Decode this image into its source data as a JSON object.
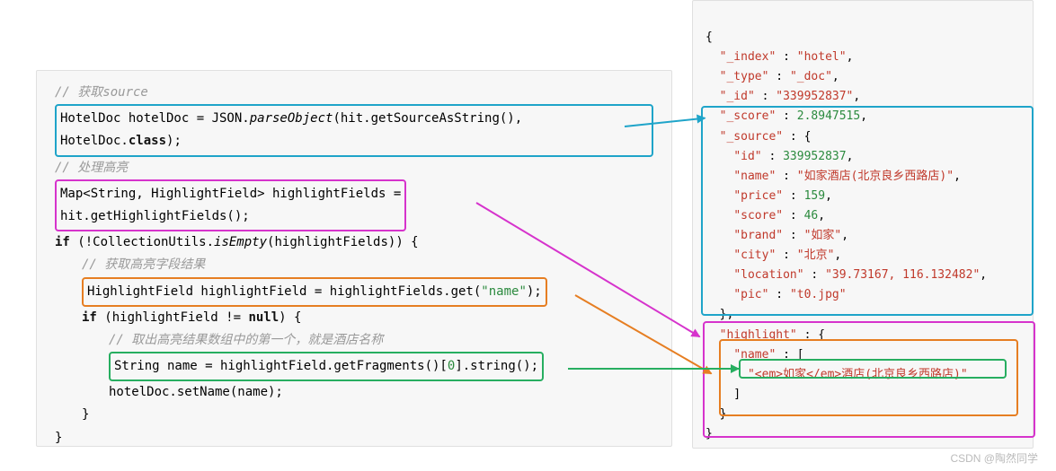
{
  "left": {
    "comment1": "// 获取source",
    "line_blue1": "HotelDoc hotelDoc = JSON.",
    "line_blue1_method": "parseObject",
    "line_blue1_tail": "(hit.getSourceAsString(),",
    "line_blue2": "HotelDoc.",
    "line_blue2_bold": "class",
    "line_blue2_tail": ");",
    "comment2": "// 处理高亮",
    "magenta_line1": "Map<String, HighlightField> highlightFields =",
    "magenta_line2": "hit.getHighlightFields();",
    "if1_a": "if",
    "if1_b": " (!CollectionUtils.",
    "if1_c": "isEmpty",
    "if1_d": "(highlightFields)) {",
    "comment3": "// 获取高亮字段结果",
    "orange_line_a": "HighlightField highlightField = highlightFields.get(",
    "orange_line_str": "\"name\"",
    "orange_line_b": ");",
    "if2_a": "if",
    "if2_b": " (highlightField != ",
    "if2_null": "null",
    "if2_c": ") {",
    "comment4": "// 取出高亮结果数组中的第一个，就是酒店名称",
    "green_line_a": "String name = highlightField.getFragments()[",
    "green_line_idx": "0",
    "green_line_b": "].string();",
    "setname": "hotelDoc.setName(name);",
    "closebrace": "}"
  },
  "right": {
    "open": "{",
    "indent": "  ",
    "index_k": "\"_index\"",
    "index_v": "\"hotel\"",
    "type_k": "\"_type\"",
    "type_v": "\"_doc\"",
    "id_k": "\"_id\"",
    "id_v": "\"339952837\"",
    "score_k": "\"_score\"",
    "score_v": "2.8947515",
    "source_k": "\"_source\"",
    "src_id_k": "\"id\"",
    "src_id_v": "339952837",
    "src_name_k": "\"name\"",
    "src_name_v": "\"如家酒店(北京良乡西路店)\"",
    "src_price_k": "\"price\"",
    "src_price_v": "159",
    "src_score_k": "\"score\"",
    "src_score_v": "46",
    "src_brand_k": "\"brand\"",
    "src_brand_v": "\"如家\"",
    "src_city_k": "\"city\"",
    "src_city_v": "\"北京\"",
    "src_loc_k": "\"location\"",
    "src_loc_v": "\"39.73167, 116.132482\"",
    "src_pic_k": "\"pic\"",
    "src_pic_v": "\"t0.jpg\"",
    "highlight_k": "\"highlight\"",
    "hl_name_k": "\"name\"",
    "hl_name_v": "\"<em>如家</em>酒店(北京良乡西路店)\"",
    "close": "}"
  },
  "watermark": "CSDN @陶然同学"
}
